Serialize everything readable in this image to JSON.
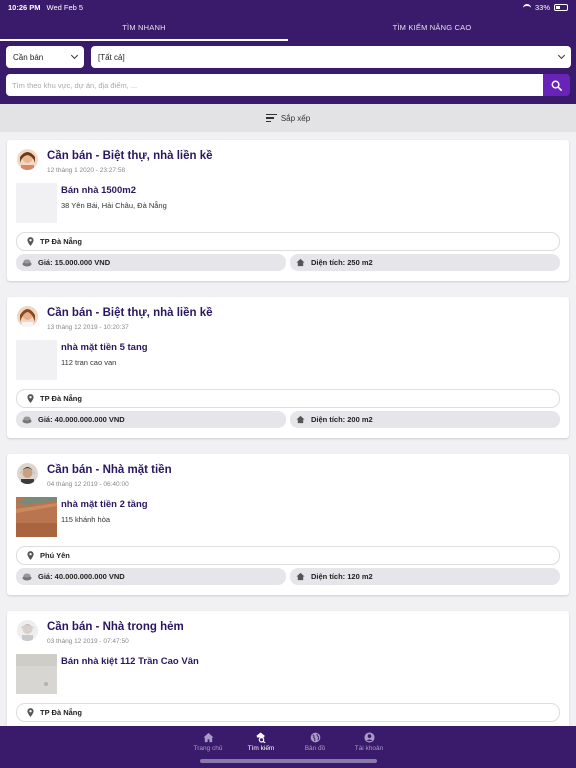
{
  "status_bar": {
    "time": "10:26 PM",
    "date": "Wed Feb 5",
    "battery": "33%"
  },
  "tabs": [
    {
      "label": "TÌM NHANH",
      "active": true
    },
    {
      "label": "TÌM KIẾM NÂNG CAO",
      "active": false
    }
  ],
  "filters": {
    "type_value": "Cần bán",
    "category_value": "[Tất cả]",
    "search_placeholder": "Tìm theo khu vực, dự án, địa điểm, ..."
  },
  "sort": {
    "label": "Sắp xếp"
  },
  "listings": [
    {
      "title": "Cần bán - Biệt thự, nhà liền kề",
      "date": "12 tháng 1 2020 - 23:27:58",
      "name": "Bán nhà 1500m2",
      "address": "38 Yên Bái, Hải Châu, Đà Nẵng",
      "location": "TP Đà Nẵng",
      "price": "Giá: 15.000.000 VND",
      "area": "Diện tích: 250 m2"
    },
    {
      "title": "Cần bán - Biệt thự, nhà liền kề",
      "date": "13 tháng 12 2019 - 10:20:37",
      "name": "nhà mặt tiền 5 tang",
      "address": "112 tran cao van",
      "location": "TP Đà Nẵng",
      "price": "Giá: 40.000.000.000 VND",
      "area": "Diện tích: 200 m2"
    },
    {
      "title": "Cần bán - Nhà mặt tiền",
      "date": "04 tháng 12 2019 - 06:40:00",
      "name": "nhà mặt tiền 2 tầng",
      "address": "115 khánh hòa",
      "location": "Phú Yên",
      "price": "Giá: 40.000.000.000 VND",
      "area": "Diện tích: 120 m2"
    },
    {
      "title": "Cần bán - Nhà trong hẻm",
      "date": "03 tháng 12 2019 - 07:47:50",
      "name": "Bán nhà kiệt 112 Trần Cao Vân",
      "address": "",
      "location": "TP Đà Nẵng",
      "price": "",
      "area": ""
    }
  ],
  "bottom_nav": [
    {
      "label": "Trang chủ",
      "icon": "home-icon",
      "active": false
    },
    {
      "label": "Tìm kiếm",
      "icon": "search-home-icon",
      "active": true
    },
    {
      "label": "Bản đồ",
      "icon": "globe-icon",
      "active": false
    },
    {
      "label": "Tài khoản",
      "icon": "account-icon",
      "active": false
    }
  ],
  "colors": {
    "primary": "#3a1a6b",
    "accent": "#6a23b8",
    "title": "#2b1660"
  }
}
